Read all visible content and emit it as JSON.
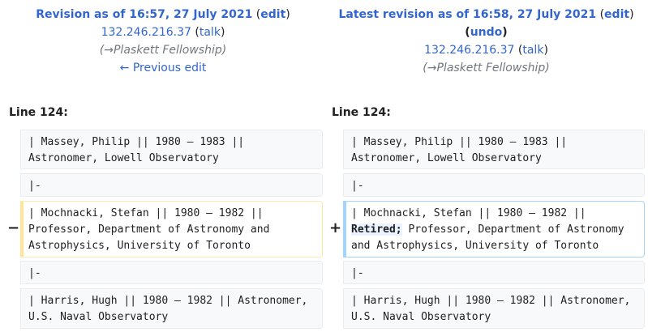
{
  "left_header": {
    "title": "Revision as of 16:57, 27 July 2021",
    "open_paren": "(",
    "edit": "edit",
    "close_paren": ")",
    "user": "132.246.216.37",
    "talk_open": "(",
    "talk": "talk",
    "talk_close": ")",
    "summary_open": "(",
    "summary_arrow": "→",
    "summary_section": "Plaskett Fellowship",
    "summary_close": ")",
    "prev_edit": "← Previous edit"
  },
  "right_header": {
    "title": "Latest revision as of 16:58, 27 July 2021",
    "open_paren": "(",
    "edit": "edit",
    "close_paren": ")",
    "undo_open": "(",
    "undo": "undo",
    "undo_close": ")",
    "user": "132.246.216.37",
    "talk_open": "(",
    "talk": "talk",
    "talk_close": ")",
    "summary_open": "(",
    "summary_arrow": "→",
    "summary_section": "Plaskett Fellowship",
    "summary_close": ")"
  },
  "line_left": "Line 124:",
  "line_right": "Line 124:",
  "rows": {
    "r1_left": "| Massey, Philip || 1980 – 1983 ||\nAstronomer, Lowell Observatory",
    "r1_right": "| Massey, Philip || 1980 – 1983 ||\nAstronomer, Lowell Observatory",
    "r2_left": "|-",
    "r2_right": "|-",
    "r3_left": "| Mochnacki, Stefan || 1980 – 1982 ||\nProfessor, Department of Astronomy and\nAstrophysics, University of Toronto",
    "r3_right_a": "| Mochnacki, Stefan || 1980 – 1982 || ",
    "r3_right_ins": "Retired;",
    "r3_right_b": " Professor, Department of Astronomy\nand Astrophysics, University of Toronto",
    "r4_left": "|-",
    "r4_right": "|-",
    "r5_left": "| Harris, Hugh || 1980 – 1982 || Astronomer,\nU.S. Naval Observatory",
    "r5_right": "| Harris, Hugh || 1980 – 1982 || Astronomer,\nU.S. Naval Observatory"
  },
  "markers": {
    "minus": "−",
    "plus": "+"
  }
}
